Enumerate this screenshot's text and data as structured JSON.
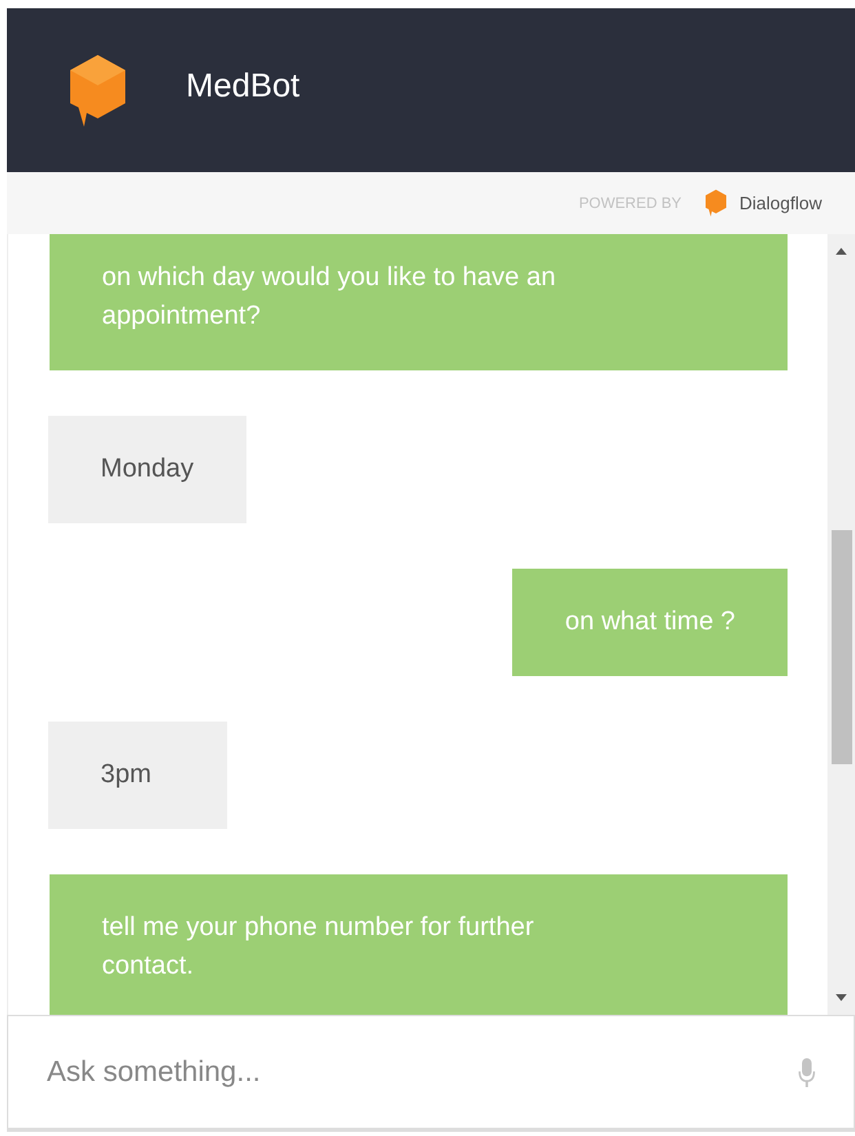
{
  "header": {
    "title": "MedBot"
  },
  "powered_by": {
    "label": "POWERED BY",
    "brand": "Dialogflow"
  },
  "messages": [
    {
      "kind": "bot",
      "text": "on which day would you like to have an appointment?"
    },
    {
      "kind": "user",
      "text": "Monday"
    },
    {
      "kind": "bot",
      "text": "on what time ?"
    },
    {
      "kind": "user",
      "text": "3pm"
    },
    {
      "kind": "bot",
      "text": "tell me your phone number for further contact."
    }
  ],
  "input": {
    "placeholder": "Ask something..."
  }
}
